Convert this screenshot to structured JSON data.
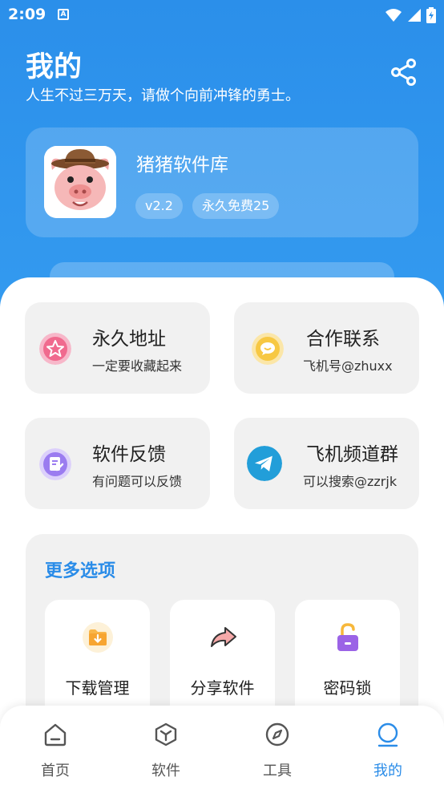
{
  "status_bar": {
    "time": "2:09",
    "notif_icon_letter": "A",
    "icons": [
      "wifi-icon",
      "signal-icon",
      "battery-icon"
    ]
  },
  "header": {
    "title": "我的",
    "subtitle": "人生不过三万天，请做个向前冲锋的勇士。",
    "share_icon": "share-icon"
  },
  "profile": {
    "app_name": "猪猪软件库",
    "version": "v2.2",
    "badge": "永久免费25"
  },
  "tiles": [
    {
      "title": "永久地址",
      "subtitle": "一定要收藏起来",
      "icon": "star-icon",
      "color": "#f06a8e"
    },
    {
      "title": "合作联系",
      "subtitle": "飞机号@zhuxx",
      "icon": "chat-bubble-icon",
      "color": "#f7c843"
    },
    {
      "title": "软件反馈",
      "subtitle": "有问题可以反馈",
      "icon": "feedback-icon",
      "color": "#9b7cf0"
    },
    {
      "title": "飞机频道群",
      "subtitle": "可以搜索@zzrjk",
      "icon": "telegram-icon",
      "color": "#229ed9"
    }
  ],
  "more": {
    "title": "更多选项",
    "options": [
      {
        "label": "下载管理",
        "icon": "download-folder-icon"
      },
      {
        "label": "分享软件",
        "icon": "share-arrow-icon"
      },
      {
        "label": "密码锁",
        "icon": "unlock-icon"
      }
    ]
  },
  "tabbar": {
    "tabs": [
      {
        "label": "首页",
        "icon": "home-icon"
      },
      {
        "label": "软件",
        "icon": "package-icon"
      },
      {
        "label": "工具",
        "icon": "compass-icon"
      },
      {
        "label": "我的",
        "icon": "profile-icon"
      }
    ],
    "active_index": 3
  },
  "colors": {
    "primary": "#2a8ce8",
    "tile_bg": "#f1f1f1"
  }
}
